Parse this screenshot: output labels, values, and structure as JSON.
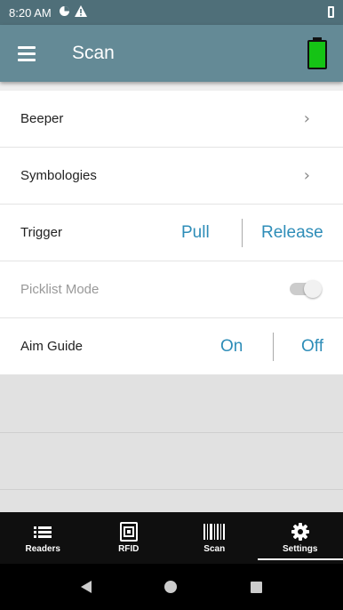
{
  "status_bar": {
    "time": "8:20 AM"
  },
  "app_bar": {
    "title": "Scan",
    "battery_level": 1.0,
    "battery_color": "#15c315"
  },
  "settings": {
    "beeper": {
      "label": "Beeper"
    },
    "symbologies": {
      "label": "Symbologies"
    },
    "trigger": {
      "label": "Trigger",
      "option_a": "Pull",
      "option_b": "Release"
    },
    "picklist_mode": {
      "label": "Picklist Mode",
      "enabled": false
    },
    "aim_guide": {
      "label": "Aim Guide",
      "option_a": "On",
      "option_b": "Off"
    }
  },
  "tabs": [
    {
      "label": "Readers",
      "icon": "list-icon"
    },
    {
      "label": "RFID",
      "icon": "rfid-icon"
    },
    {
      "label": "Scan",
      "icon": "barcode-icon"
    },
    {
      "label": "Settings",
      "icon": "gear-icon",
      "active": true
    }
  ],
  "colors": {
    "accent": "#2e8db8",
    "app_bar": "#648a96",
    "status_bar": "#4f6f79"
  }
}
